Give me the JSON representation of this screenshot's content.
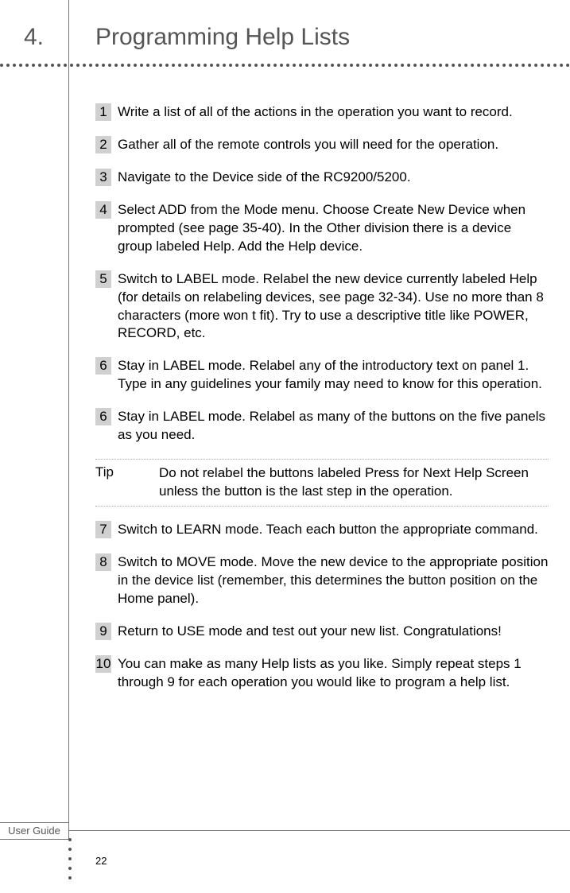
{
  "heading": {
    "number": "4.",
    "title": "Programming Help Lists"
  },
  "steps_a": [
    {
      "n": "1",
      "t": "Write a list of all of the actions in the operation you want to record."
    },
    {
      "n": "2",
      "t": "Gather all of the remote controls you will need for the operation."
    },
    {
      "n": "3",
      "t": "Navigate to the Device side of the RC9200/5200."
    },
    {
      "n": "4",
      "t": "Select ADD from the Mode menu. Choose  Create New Device  when prompted (see page 35-40).\nIn the  Other  division there is a device group labeled  Help.  Add the Help device."
    },
    {
      "n": "5",
      "t": "Switch to LABEL mode. Relabel the new device currently labeled Help (for details on relabeling devices, see page 32-34). Use no more than 8 characters (more won t fit). Try to use a descriptive title like POWER, RECORD, etc."
    },
    {
      "n": "6",
      "t": "Stay in LABEL mode. Relabel any of the introductory text on panel 1. Type in any guidelines your family may need to know for this operation."
    },
    {
      "n": "6",
      "t": "Stay in LABEL mode. Relabel as many of the buttons on the five panels as you need."
    }
  ],
  "tip": {
    "label": "Tip",
    "text": "Do not relabel the buttons labeled  Press for Next Help Screen  unless the button is the last step in the operation."
  },
  "steps_b": [
    {
      "n": "7",
      "t": "Switch to LEARN mode. Teach each button the appropriate command."
    },
    {
      "n": "8",
      "t": "Switch to MOVE mode. Move the new device to the appropriate position in the device list (remember, this determines the button position on the Home panel)."
    },
    {
      "n": "9",
      "t": "Return to USE mode and test out your new list. Congratulations!"
    },
    {
      "n": "10",
      "t": "You can make as many Help lists as you like. Simply repeat steps 1 through 9 for each operation you would like to program a help list."
    }
  ],
  "footer": {
    "label": "User Guide",
    "page": "22"
  }
}
